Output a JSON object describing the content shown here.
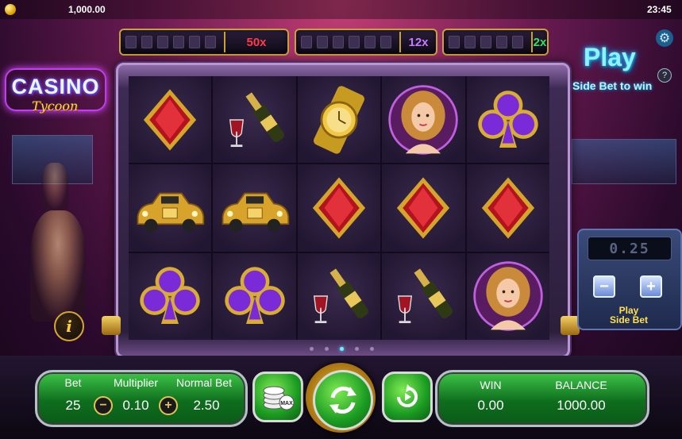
{
  "status_bar": {
    "balance": "1,000.00",
    "time": "23:45",
    "coin_icon": "coin-icon"
  },
  "multipliers": [
    {
      "label": "50x",
      "color": "#ff3b4a"
    },
    {
      "label": "12x",
      "color": "#c27bff"
    },
    {
      "label": "2x",
      "color": "#36e05a"
    }
  ],
  "logo": {
    "main": "CASINO",
    "sub": "Tycoon"
  },
  "side_bet": {
    "title": "Play",
    "subtitle": "Side Bet to win",
    "value": "0.25",
    "play_label_1": "Play",
    "play_label_2": "Side Bet",
    "minus": "−",
    "plus": "+",
    "help": "?"
  },
  "reels": [
    [
      "diamond",
      "champagne",
      "watch",
      "lady",
      "club"
    ],
    [
      "car",
      "car",
      "diamond",
      "diamond",
      "diamond"
    ],
    [
      "club",
      "club",
      "champagne",
      "champagne",
      "lady"
    ]
  ],
  "reel_page_dots": 5,
  "reel_page_active": 2,
  "info_label": "i",
  "bet_panel": {
    "bet_label": "Bet",
    "bet_value": "25",
    "multiplier_label": "Multiplier",
    "multiplier_value": "0.10",
    "normal_bet_label": "Normal Bet",
    "normal_bet_value": "2.50",
    "minus": "−",
    "plus": "+"
  },
  "max_bet_label": "MAX",
  "win_panel": {
    "win_label": "WIN",
    "win_value": "0.00",
    "balance_label": "BALANCE",
    "balance_value": "1000.00"
  },
  "colors": {
    "accent_green": "#2db63c",
    "gold": "#e3c34f",
    "frame_purple": "#b995d0"
  }
}
